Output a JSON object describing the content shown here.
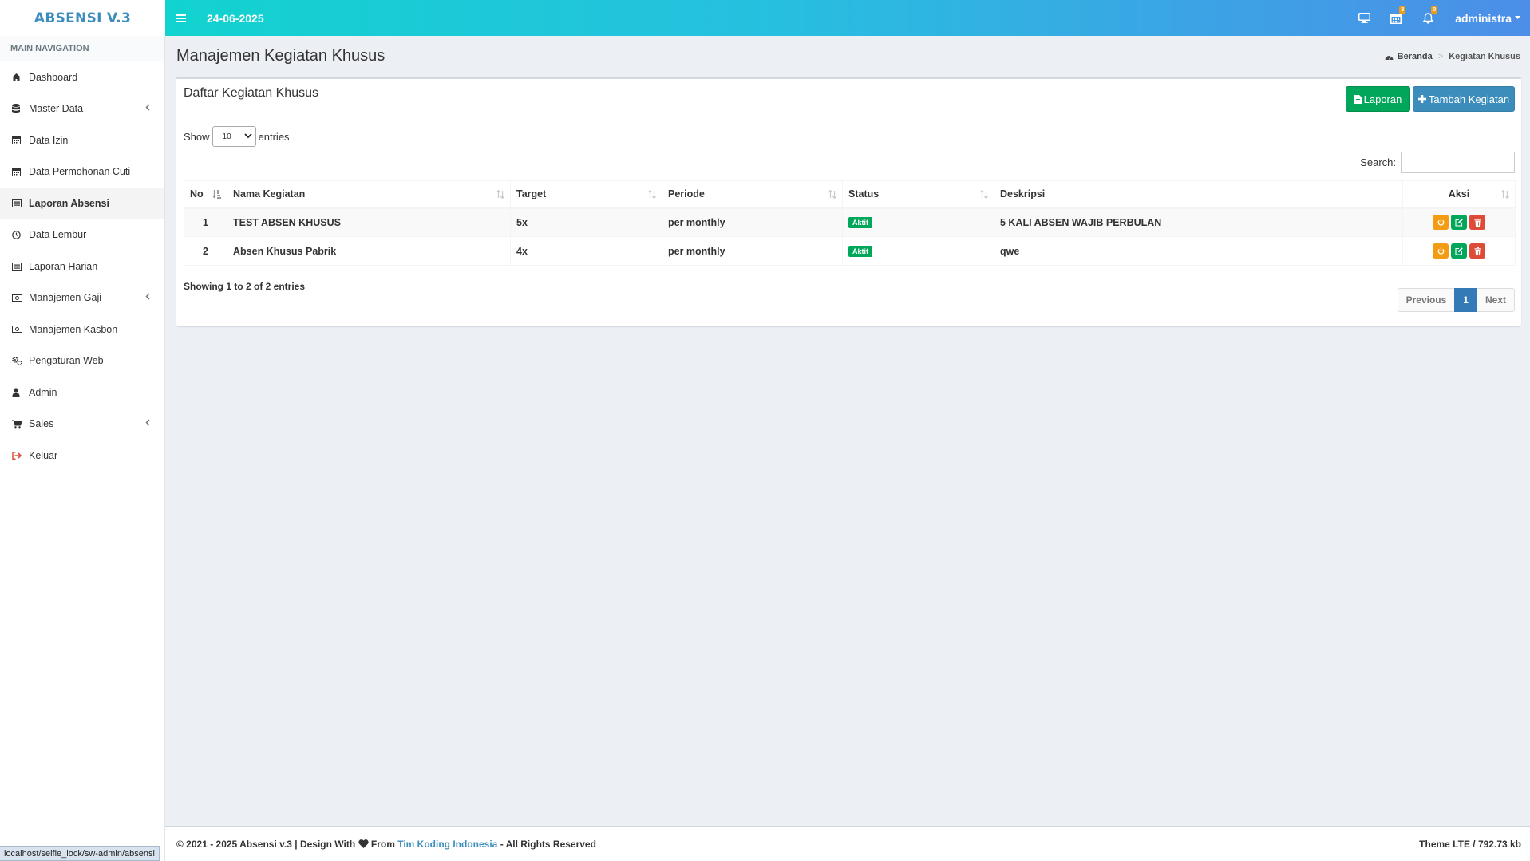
{
  "app": {
    "logo": "ABSENSI V.3"
  },
  "navbar": {
    "date": "24-06-2025",
    "calendar_badge": "3",
    "bell_badge": "0",
    "user": "administra"
  },
  "sidebar": {
    "header": "MAIN NAVIGATION",
    "items": [
      {
        "label": "Dashboard",
        "icon": "home-icon"
      },
      {
        "label": "Master Data",
        "icon": "database-icon"
      },
      {
        "label": "Data Izin",
        "icon": "calendar-icon"
      },
      {
        "label": "Data Permohonan Cuti",
        "icon": "calendar-icon"
      },
      {
        "label": "Laporan Absensi",
        "icon": "list-icon"
      },
      {
        "label": "Data Lembur",
        "icon": "clock-icon"
      },
      {
        "label": "Laporan Harian",
        "icon": "list-icon"
      },
      {
        "label": "Manajemen Gaji",
        "icon": "money-icon"
      },
      {
        "label": "Manajemen Kasbon",
        "icon": "money-icon"
      },
      {
        "label": "Pengaturan Web",
        "icon": "gears-icon"
      },
      {
        "label": "Admin",
        "icon": "user-icon"
      },
      {
        "label": "Sales",
        "icon": "cart-icon"
      },
      {
        "label": "Keluar",
        "icon": "sign-out-icon"
      }
    ]
  },
  "page": {
    "title": "Manajemen Kegiatan Khusus",
    "breadcrumb_home": "Beranda",
    "breadcrumb_current": "Kegiatan Khusus"
  },
  "box": {
    "title": "Daftar Kegiatan Khusus",
    "btn_laporan": "Laporan",
    "btn_tambah": "Tambah Kegiatan",
    "show_label": "Show",
    "show_value": "10",
    "entries_label": "entries",
    "search_label": "Search:",
    "search_value": ""
  },
  "table": {
    "columns": [
      "No",
      "Nama Kegiatan",
      "Target",
      "Periode",
      "Status",
      "Deskripsi",
      "Aksi"
    ],
    "rows": [
      {
        "no": "1",
        "nama": "TEST ABSEN KHUSUS",
        "target": "5x",
        "periode": "per monthly",
        "status": "Aktif",
        "deskripsi": "5 KALI ABSEN WAJIB PERBULAN"
      },
      {
        "no": "2",
        "nama": "Absen Khusus Pabrik",
        "target": "4x",
        "periode": "per monthly",
        "status": "Aktif",
        "deskripsi": "qwe"
      }
    ],
    "info": "Showing 1 to 2 of 2 entries",
    "pagination": {
      "previous": "Previous",
      "current": "1",
      "next": "Next"
    }
  },
  "footer": {
    "left_prefix": "© 2021 - 2025 Absensi v.3 | Design With",
    "left_from": "From",
    "link": "Tim Koding Indonesia",
    "left_suffix": "- All Rights Reserved",
    "right": "Theme LTE / 792.73 kb"
  },
  "statusbar": {
    "url": "localhost/selfie_lock/sw-admin/absensi"
  },
  "colors": {
    "accent": "#3c8dbc",
    "success": "#00a65a",
    "warning": "#f39c12",
    "danger": "#dd4b39"
  }
}
